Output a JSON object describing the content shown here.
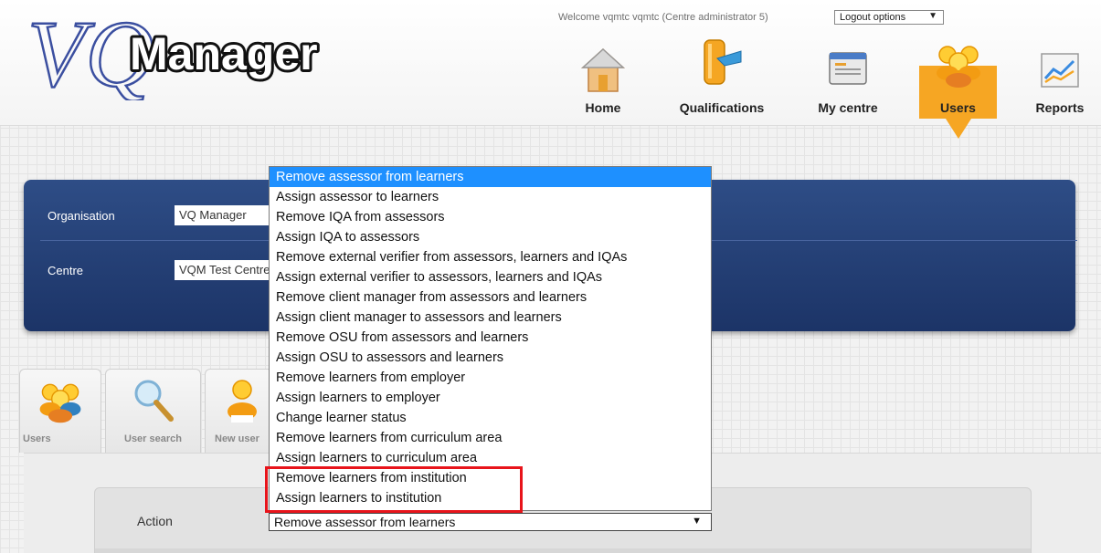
{
  "header": {
    "logo_text": "VQManager",
    "welcome_text": "Welcome vqmtc vqmtc (Centre administrator 5)",
    "logout_label": "Logout options"
  },
  "nav": {
    "home": "Home",
    "qualifications": "Qualifications",
    "my_centre": "My centre",
    "users": "Users",
    "reports": "Reports",
    "active": "users"
  },
  "org_panel": {
    "organisation_label": "Organisation",
    "organisation_value": "VQ Manager",
    "centre_label": "Centre",
    "centre_value": "VQM Test Centre"
  },
  "tabs": {
    "users": "Users",
    "user_search": "User search",
    "new_user": "New user"
  },
  "form": {
    "action_label": "Action",
    "action_value": "Remove assessor from learners"
  },
  "dropdown": {
    "options": [
      "Remove assessor from learners",
      "Assign assessor to learners",
      "Remove IQA from assessors",
      "Assign IQA to assessors",
      "Remove external verifier from assessors, learners and IQAs",
      "Assign external verifier to assessors, learners and IQAs",
      "Remove client manager from assessors and learners",
      "Assign client manager to assessors and learners",
      "Remove OSU from assessors and learners",
      "Assign OSU to assessors and learners",
      "Remove learners from employer",
      "Assign learners to employer",
      "Change learner status",
      "Remove learners from curriculum area",
      "Assign learners to curriculum area",
      "Remove learners from institution",
      "Assign learners to institution"
    ],
    "selected_index": 0,
    "highlighted_options": [
      "Remove learners from institution",
      "Assign learners to institution"
    ]
  },
  "colors": {
    "accent_orange": "#f6a623",
    "panel_blue": "#1c3467",
    "selection_blue": "#1e90ff",
    "highlight_red": "#e8141b"
  },
  "icons": {
    "home": "home-icon",
    "qualifications": "qualifications-icon",
    "my_centre": "my-centre-icon",
    "users": "users-icon",
    "reports": "reports-icon",
    "user_search": "search-icon",
    "new_user": "new-user-icon"
  }
}
